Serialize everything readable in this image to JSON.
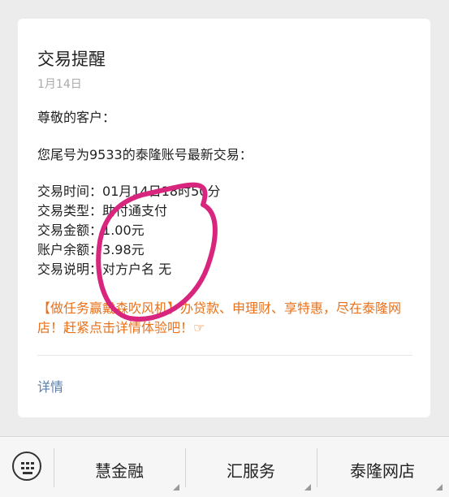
{
  "message": {
    "title": "交易提醒",
    "date": "1月14日",
    "greeting": "尊敬的客户：",
    "intro": "您尾号为9533的泰隆账号最新交易：",
    "rows": [
      {
        "label": "交易时间：",
        "value": "01月14日18时50分"
      },
      {
        "label": "交易类型：",
        "value": "助付通支付"
      },
      {
        "label": "交易金额：",
        "value": "1.00元"
      },
      {
        "label": "账户余额：",
        "value": "3.98元"
      },
      {
        "label": "交易说明：",
        "value": "对方户名 无"
      }
    ],
    "promo": "【做任务赢戴森吹风机】办贷款、申理财、享特惠，尽在泰隆网店！赶紧点击详情体验吧！☞",
    "detail_link": "详情"
  },
  "bottom_menu": {
    "items": [
      {
        "label": "慧金融"
      },
      {
        "label": "汇服务"
      },
      {
        "label": "泰隆网店"
      }
    ]
  },
  "colors": {
    "promo": "#e8711a",
    "link": "#5a7daa",
    "annotation": "#d8257e"
  },
  "icons": {
    "keyboard": "keyboard-icon",
    "submenu": "submenu-indicator-icon"
  }
}
